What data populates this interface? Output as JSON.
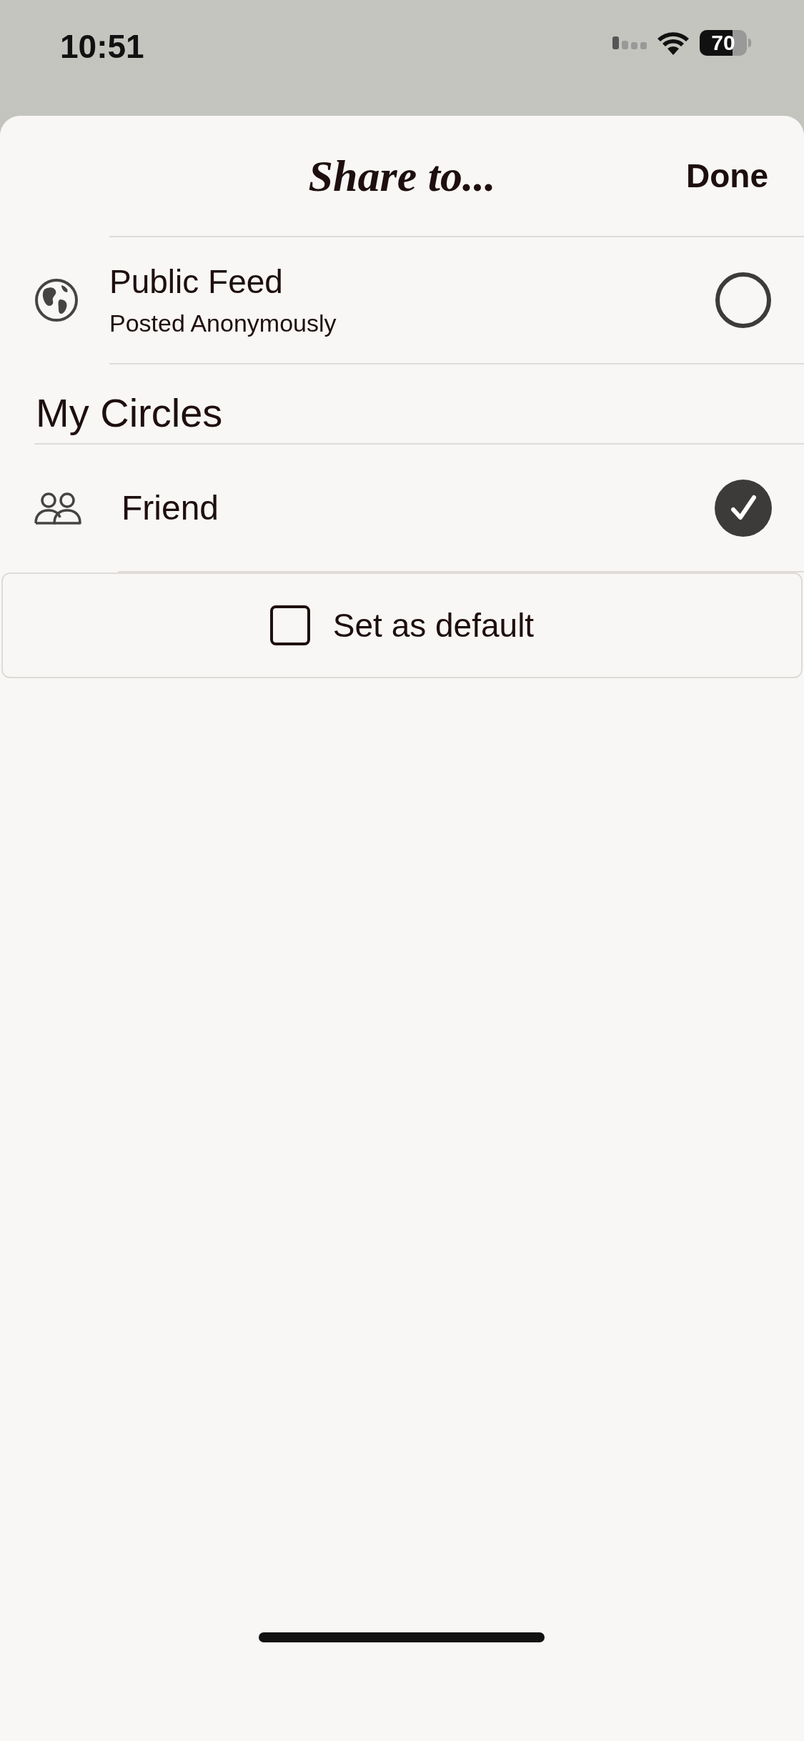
{
  "status_bar": {
    "time": "10:51",
    "battery": "70"
  },
  "header": {
    "title": "Share to...",
    "done": "Done"
  },
  "destinations": [
    {
      "kind": "public",
      "title": "Public Feed",
      "subtitle": "Posted Anonymously",
      "selected": false
    }
  ],
  "circles": {
    "heading": "My Circles",
    "items": [
      {
        "label": "Friend",
        "selected": true
      }
    ]
  },
  "default_option": {
    "label": "Set as default",
    "checked": false
  }
}
